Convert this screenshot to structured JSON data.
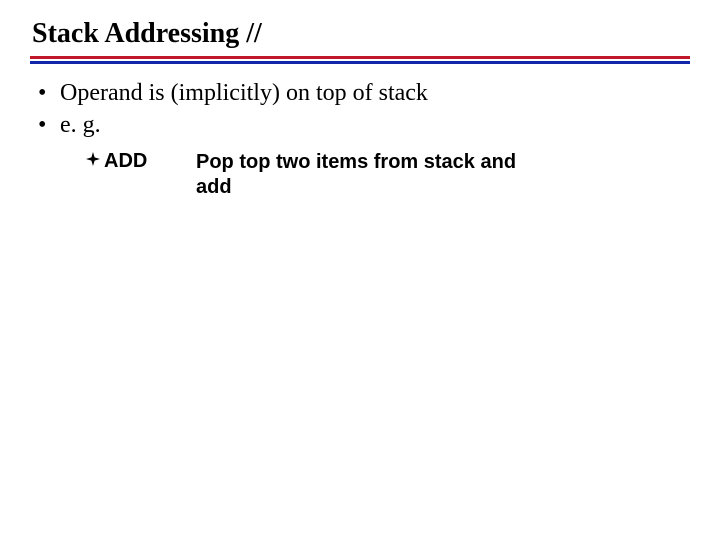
{
  "title": "Stack Addressing //",
  "bullets": {
    "item0": "Operand is (implicitly) on top of stack",
    "item1": "e. g."
  },
  "sub": {
    "mnemonic": "ADD",
    "description": "Pop top two items from stack and add"
  }
}
